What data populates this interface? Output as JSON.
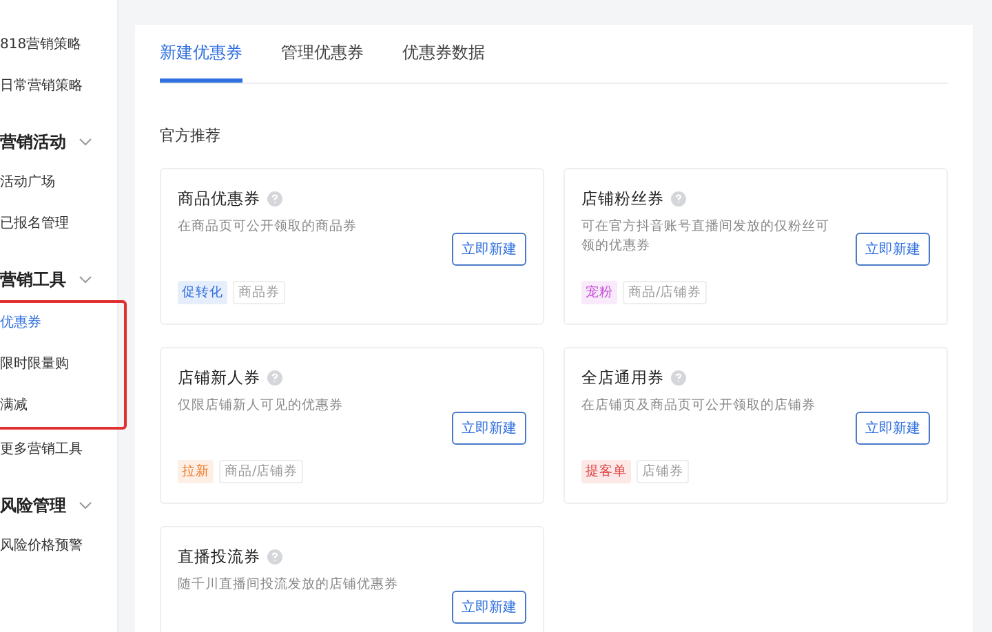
{
  "sidebar": {
    "groups": [
      {
        "items": [
          {
            "label": "818营销策略",
            "selected": false
          },
          {
            "label": "日常营销策略",
            "selected": false
          }
        ]
      },
      {
        "title": "营销活动",
        "expanded": true,
        "items": [
          {
            "label": "活动广场",
            "selected": false
          },
          {
            "label": "已报名管理",
            "selected": false
          }
        ]
      },
      {
        "title": "营销工具",
        "expanded": true,
        "highlighted": true,
        "items": [
          {
            "label": "优惠券",
            "selected": true
          },
          {
            "label": "限时限量购",
            "selected": false
          },
          {
            "label": "满减",
            "selected": false
          }
        ],
        "extra_items": [
          {
            "label": "更多营销工具",
            "selected": false
          }
        ]
      },
      {
        "title": "风险管理",
        "expanded": true,
        "items": [
          {
            "label": "风险价格预警",
            "selected": false
          }
        ]
      }
    ]
  },
  "tabs": [
    {
      "label": "新建优惠券",
      "selected": true
    },
    {
      "label": "管理优惠券",
      "selected": false
    },
    {
      "label": "优惠券数据",
      "selected": false
    }
  ],
  "section_title": "官方推荐",
  "cards": [
    {
      "title": "商品优惠券",
      "description": "在商品页可公开领取的商品券",
      "button": "立即新建",
      "tags": [
        {
          "label": "促转化",
          "color": "#2f6fe0"
        },
        {
          "label": "商品券"
        }
      ]
    },
    {
      "title": "店铺粉丝券",
      "description": "可在官方抖音账号直播间发放的仅粉丝可领的优惠券",
      "button": "立即新建",
      "tags": [
        {
          "label": "宠粉",
          "color": "#c34fd6"
        },
        {
          "label": "商品/店铺券"
        }
      ]
    },
    {
      "title": "店铺新人券",
      "description": "仅限店铺新人可见的优惠券",
      "button": "立即新建",
      "tags": [
        {
          "label": "拉新",
          "color": "#f07a2a"
        },
        {
          "label": "商品/店铺券"
        }
      ]
    },
    {
      "title": "全店通用券",
      "description": "在店铺页及商品页可公开领取的店铺券",
      "button": "立即新建",
      "tags": [
        {
          "label": "提客单",
          "color": "#e0403d"
        },
        {
          "label": "店铺券"
        }
      ]
    },
    {
      "title": "直播投流券",
      "description": "随千川直播间投流发放的店铺优惠券",
      "button": "立即新建"
    }
  ]
}
